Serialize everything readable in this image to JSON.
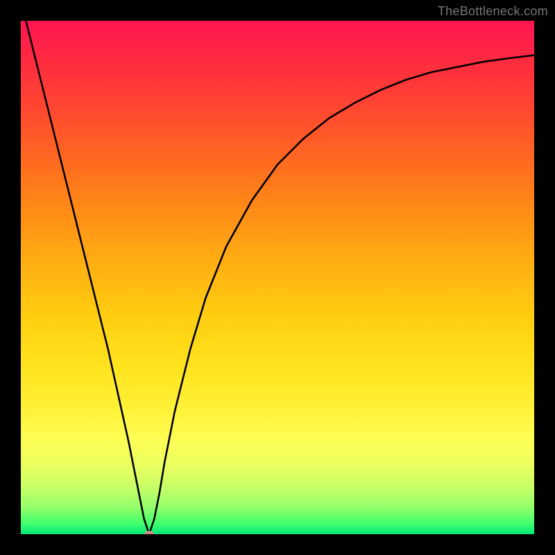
{
  "watermark": "TheBottleneck.com",
  "chart_data": {
    "type": "line",
    "title": "",
    "xlabel": "",
    "ylabel": "",
    "xlim": [
      0,
      100
    ],
    "ylim": [
      0,
      100
    ],
    "x": [
      1,
      3,
      5,
      7,
      9,
      11,
      13,
      15,
      17,
      19,
      21,
      23,
      24,
      25,
      26,
      27,
      28,
      30,
      33,
      36,
      40,
      45,
      50,
      55,
      60,
      65,
      70,
      75,
      80,
      85,
      90,
      95,
      100
    ],
    "values": [
      100,
      92,
      84,
      76,
      68,
      60,
      52,
      44,
      36,
      27,
      18,
      8,
      3,
      0,
      3,
      8,
      14,
      24,
      36,
      46,
      56,
      65,
      72,
      77,
      81,
      84,
      86.5,
      88.5,
      90,
      91,
      92,
      92.7,
      93.3
    ],
    "marker": {
      "x": 25,
      "y": 0
    },
    "colors": {
      "curve": "#000000",
      "marker": "#cd8d86",
      "gradient_top": "#ff1552",
      "gradient_bottom": "#00e87a"
    }
  }
}
